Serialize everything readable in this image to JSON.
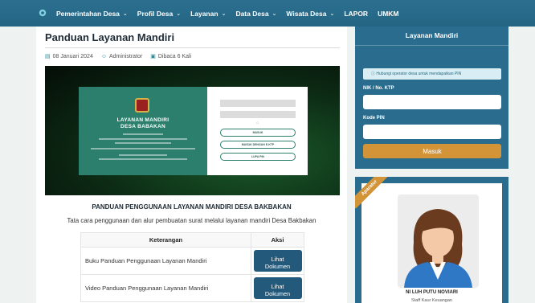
{
  "nav": {
    "home_icon": "gear-icon",
    "items": [
      {
        "label": "Pemerintahan Desa",
        "dropdown": true
      },
      {
        "label": "Profil Desa",
        "dropdown": true
      },
      {
        "label": "Layanan",
        "dropdown": true
      },
      {
        "label": "Data Desa",
        "dropdown": true
      },
      {
        "label": "Wisata Desa",
        "dropdown": true
      },
      {
        "label": "LAPOR",
        "dropdown": false
      },
      {
        "label": "UMKM",
        "dropdown": false
      }
    ]
  },
  "article": {
    "title": "Panduan Layanan Mandiri",
    "date": "08 Januari 2024",
    "author": "Administrator",
    "views": "Dibaca 6 Kali",
    "heading": "PANDUAN PENGGUNAAN LAYANAN MANDIRI DESA BAKBAKAN",
    "description": "Tata cara penggunaan dan alur pembuatan surat melalui layanan mandiri Desa Bakbakan"
  },
  "banner": {
    "title_line1": "LAYANAN MANDIRI",
    "title_line2": "DESA BABAKAN",
    "buttons": [
      "MASUK",
      "MASUK DENGAN E-KTP",
      "LUPA PIN"
    ]
  },
  "table": {
    "headers": [
      "Keterangan",
      "Aksi"
    ],
    "rows": [
      {
        "label": "Buku Panduan Penggunaan Layanan Mandiri",
        "action_line1": "Lihat",
        "action_line2": "Dokumen"
      },
      {
        "label": "Video Panduan Penggunaan Layanan Mandiri",
        "action_line1": "Lihat",
        "action_line2": "Dokumen"
      }
    ]
  },
  "sidebar": {
    "login": {
      "title": "Layanan Mandiri",
      "info": "Hubungi operator desa untuk mendapatkan PIN",
      "nik_label": "NIK / No. KTP",
      "pin_label": "Kode PIN",
      "submit_label": "Masuk"
    },
    "aparatur": {
      "ribbon": "Aparatur",
      "name": "NI LUH PUTU NOVIARI",
      "role": "Staff Kaur Keuangan"
    }
  },
  "colors": {
    "nav": "#2a6c8e",
    "accent": "#d29437",
    "button": "#235a7c"
  }
}
